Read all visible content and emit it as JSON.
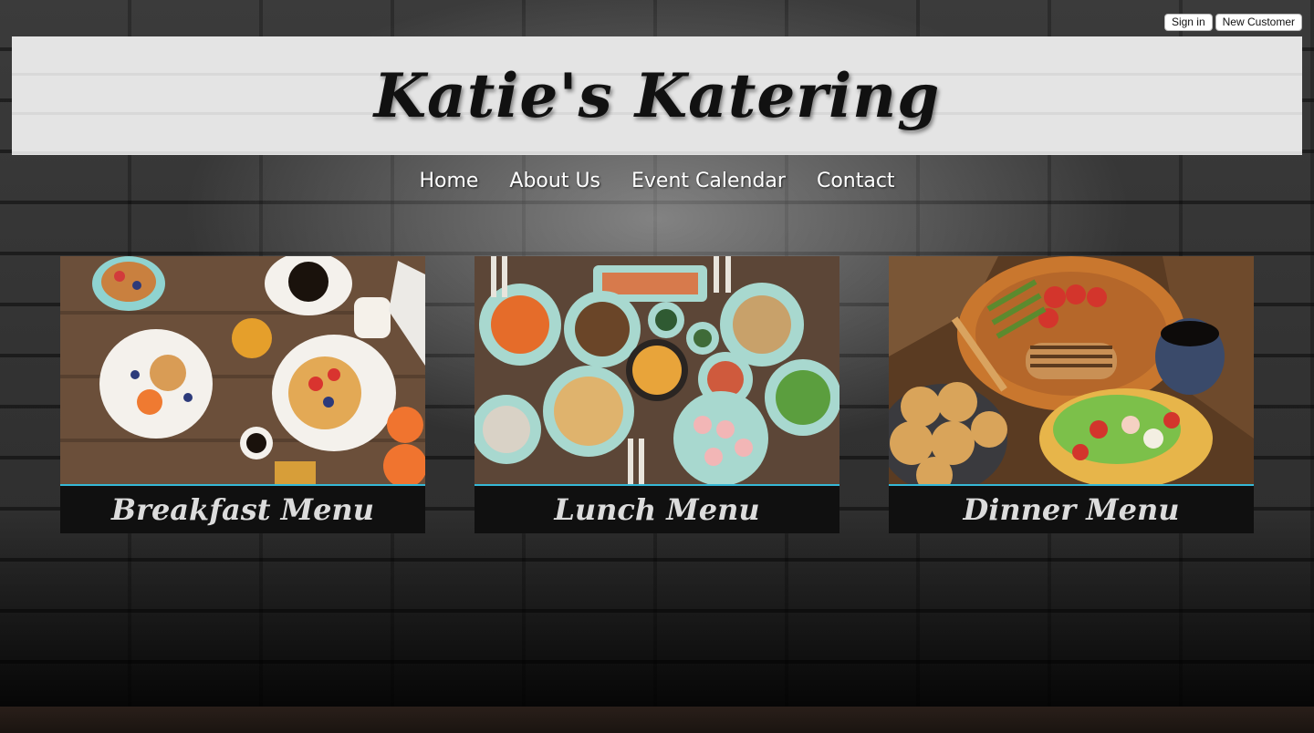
{
  "auth": {
    "sign_in": "Sign in",
    "new_customer": "New Customer"
  },
  "site": {
    "title": "Katie's Katering"
  },
  "nav": [
    {
      "label": "Home"
    },
    {
      "label": "About Us"
    },
    {
      "label": "Event Calendar"
    },
    {
      "label": "Contact"
    }
  ],
  "menus": [
    {
      "label": "Breakfast Menu",
      "image_icon": "breakfast-photo"
    },
    {
      "label": "Lunch Menu",
      "image_icon": "lunch-photo"
    },
    {
      "label": "Dinner Menu",
      "image_icon": "dinner-photo"
    }
  ],
  "colors": {
    "accent": "#36b8d6",
    "caption_bg": "#101010",
    "banner_bg": "#e4e4e4"
  }
}
